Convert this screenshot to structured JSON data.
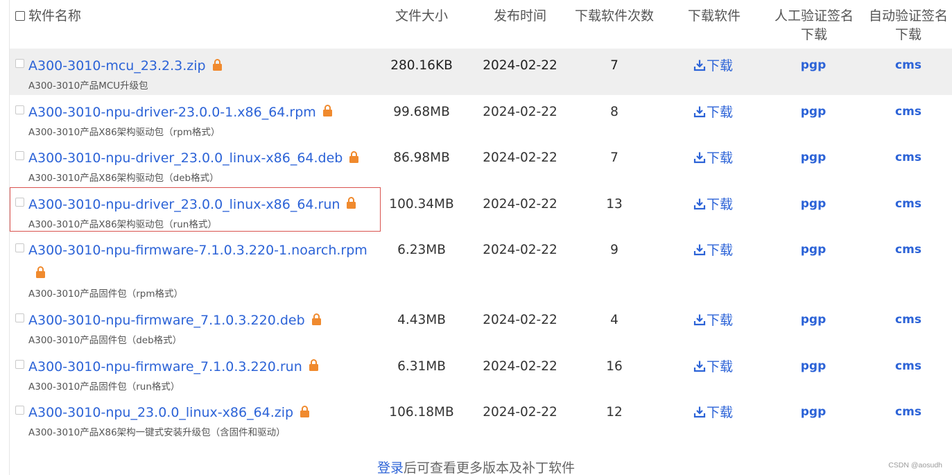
{
  "header": {
    "name": "软件名称",
    "size": "文件大小",
    "date": "发布时间",
    "count": "下载软件次数",
    "download": "下载软件",
    "manual_verify_l1": "人工验证签名",
    "manual_verify_l2": "下载",
    "auto_verify_l1": "自动验证签名",
    "auto_verify_l2": "下载"
  },
  "rows": [
    {
      "name": "A300-3010-mcu_23.2.3.zip",
      "desc": "A300-3010产品MCU升级包",
      "size": "280.16KB",
      "date": "2024-02-22",
      "count": "7",
      "download": "下载",
      "pgp": "pgp",
      "cms": "cms"
    },
    {
      "name": "A300-3010-npu-driver-23.0.0-1.x86_64.rpm",
      "desc": "A300-3010产品X86架构驱动包（rpm格式）",
      "size": "99.68MB",
      "date": "2024-02-22",
      "count": "8",
      "download": "下载",
      "pgp": "pgp",
      "cms": "cms"
    },
    {
      "name": "A300-3010-npu-driver_23.0.0_linux-x86_64.deb",
      "desc": "A300-3010产品X86架构驱动包（deb格式）",
      "size": "86.98MB",
      "date": "2024-02-22",
      "count": "7",
      "download": "下载",
      "pgp": "pgp",
      "cms": "cms"
    },
    {
      "name": "A300-3010-npu-driver_23.0.0_linux-x86_64.run",
      "desc": "A300-3010产品X86架构驱动包（run格式）",
      "size": "100.34MB",
      "date": "2024-02-22",
      "count": "13",
      "download": "下载",
      "pgp": "pgp",
      "cms": "cms"
    },
    {
      "name": "A300-3010-npu-firmware-7.1.0.3.220-1.noarch.rpm",
      "desc": "A300-3010产品固件包（rpm格式）",
      "size": "6.23MB",
      "date": "2024-02-22",
      "count": "9",
      "download": "下载",
      "pgp": "pgp",
      "cms": "cms"
    },
    {
      "name": "A300-3010-npu-firmware_7.1.0.3.220.deb",
      "desc": "A300-3010产品固件包（deb格式）",
      "size": "4.43MB",
      "date": "2024-02-22",
      "count": "4",
      "download": "下载",
      "pgp": "pgp",
      "cms": "cms"
    },
    {
      "name": "A300-3010-npu-firmware_7.1.0.3.220.run",
      "desc": "A300-3010产品固件包（run格式）",
      "size": "6.31MB",
      "date": "2024-02-22",
      "count": "16",
      "download": "下载",
      "pgp": "pgp",
      "cms": "cms"
    },
    {
      "name": "A300-3010-npu_23.0.0_linux-x86_64.zip",
      "desc": "A300-3010产品X86架构一键式安装升级包（含固件和驱动）",
      "size": "106.18MB",
      "date": "2024-02-22",
      "count": "12",
      "download": "下载",
      "pgp": "pgp",
      "cms": "cms"
    }
  ],
  "footer": {
    "login": "登录",
    "rest": "后可查看更多版本及补丁软件"
  },
  "watermark": "CSDN @aosudh",
  "colors": {
    "link": "#2c63d7",
    "lock": "#f08a2e",
    "highlight": "#d9534f",
    "shaded_row": "#efefef"
  }
}
